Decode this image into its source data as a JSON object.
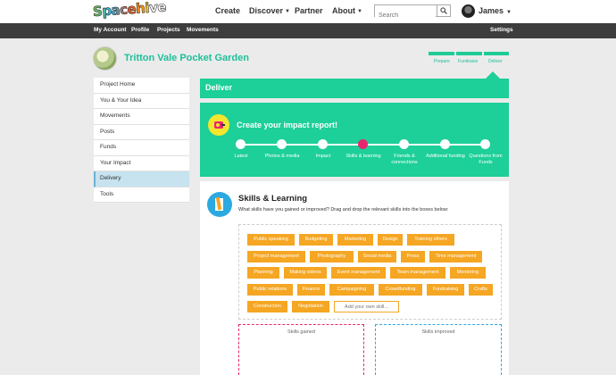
{
  "header": {
    "logo_text": "Spacehive",
    "nav": [
      {
        "label": "Create",
        "has_caret": false
      },
      {
        "label": "Discover",
        "has_caret": true
      },
      {
        "label": "Partner",
        "has_caret": false
      },
      {
        "label": "About",
        "has_caret": true
      }
    ],
    "search_placeholder": "Search",
    "user_name": "James"
  },
  "subnav": {
    "items": [
      "My Account",
      "Profile",
      "Projects",
      "Movements"
    ],
    "settings": "Settings"
  },
  "project": {
    "title": "Tritton Vale Pocket Garden",
    "stages": [
      "Prepare",
      "Fundraise",
      "Deliver"
    ]
  },
  "sidebar": {
    "items": [
      "Project Home",
      "You & Your Idea",
      "Movements",
      "Posts",
      "Funds",
      "Your Impact",
      "Delivery",
      "Tools"
    ],
    "active": "Delivery"
  },
  "deliver": {
    "heading": "Deliver",
    "impact_title": "Create your impact report!",
    "steps": [
      "Latest",
      "Photos & media",
      "Impact",
      "Skills & learning",
      "Friends & connections",
      "Additional funding",
      "Questions from Funds"
    ],
    "current_step": "Skills & learning"
  },
  "skills": {
    "title": "Skills & Learning",
    "instructions": "What skills have you gained or improved? Drag and drop the relevant skills into the boxes below:",
    "tags": [
      "Public speaking",
      "Budgeting",
      "Marketing",
      "Design",
      "Training others",
      "Project management",
      "Photography",
      "Social media",
      "Press",
      "Time management",
      "Planning",
      "Making videos",
      "Event management",
      "Team management",
      "Mentoring",
      "Public relations",
      "Finance",
      "Campaigning",
      "Crowdfunding",
      "Fundraising",
      "Crafts",
      "Construction",
      "Negotiation"
    ],
    "add_placeholder": "Add your own skill...",
    "gained_label": "Skills gained",
    "improved_label": "Skills improved"
  },
  "colors": {
    "accent_green": "#1dcf98",
    "tag_orange": "#f5a623",
    "current_step_pink": "#e8266f",
    "gained_border": "#e8266f",
    "improved_border": "#2ca9e1"
  }
}
